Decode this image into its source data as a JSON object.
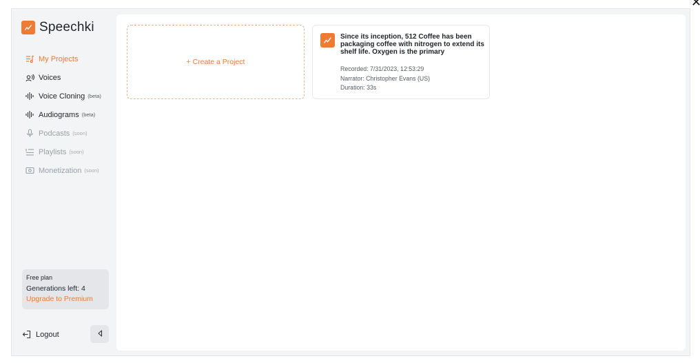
{
  "app": {
    "name": "Speechki",
    "brand_color": "#ef7a33"
  },
  "sidebar": {
    "items": [
      {
        "label": "My Projects",
        "tag": "",
        "icon": "music-list-icon",
        "state": "active"
      },
      {
        "label": "Voices",
        "tag": "",
        "icon": "voice-icon",
        "state": "enabled"
      },
      {
        "label": "Voice Cloning",
        "tag": "(beta)",
        "icon": "waveform-icon",
        "state": "enabled"
      },
      {
        "label": "Audiograms",
        "tag": "(beta)",
        "icon": "waveform-icon",
        "state": "enabled"
      },
      {
        "label": "Podcasts",
        "tag": "(soon)",
        "icon": "microphone-icon",
        "state": "disabled"
      },
      {
        "label": "Playlists",
        "tag": "(soon)",
        "icon": "playlist-icon",
        "state": "disabled"
      },
      {
        "label": "Monetization",
        "tag": "(soon)",
        "icon": "money-icon",
        "state": "disabled"
      }
    ],
    "plan": {
      "title": "Free plan",
      "generations": "Generations left: 4",
      "upgrade": "Upgrade to Premium"
    },
    "logout_label": "Logout"
  },
  "main": {
    "create_label": "+ Create a Project",
    "projects": [
      {
        "title": "Since its inception, 512 Coffee has been packaging coffee with nitrogen to extend its shelf life. Oxygen is the primary",
        "recorded": "Recorded: 7/31/2023, 12:53:29",
        "narrator": "Narrator: Christopher Evans (US)",
        "duration": "Duration: 33s"
      }
    ]
  }
}
